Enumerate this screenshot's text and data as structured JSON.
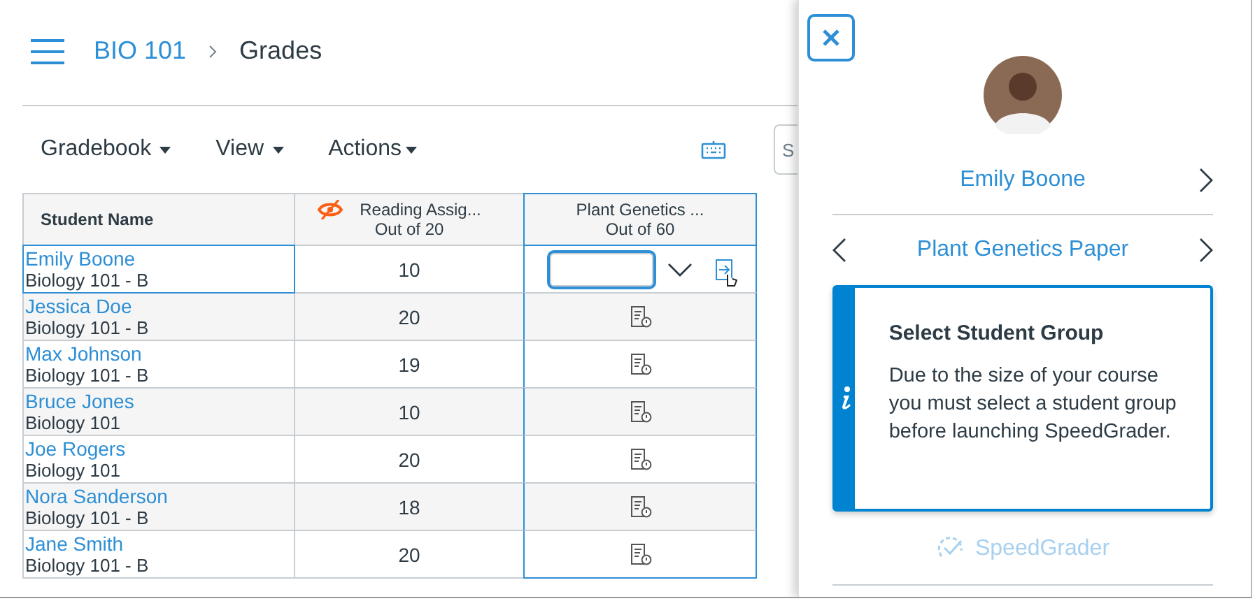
{
  "header": {
    "breadcrumb": [
      {
        "label": "BIO 101",
        "kind": "link"
      },
      {
        "label": "Grades",
        "kind": "current"
      }
    ]
  },
  "toolbar": {
    "menus": [
      {
        "label": "Gradebook"
      },
      {
        "label": "View"
      },
      {
        "label": "Actions"
      }
    ],
    "search": {
      "placeholder": "S"
    }
  },
  "table": {
    "columns": [
      {
        "title": "Student Name",
        "kind": "student"
      },
      {
        "title": "Reading Assig...",
        "subtitle": "Out of 20",
        "kind": "assignment",
        "muted": true,
        "selected": false
      },
      {
        "title": "Plant Genetics ...",
        "subtitle": "Out of 60",
        "kind": "assignment",
        "muted": false,
        "selected": true
      }
    ],
    "rows": [
      {
        "name": "Emily Boone",
        "section": "Biology 101 - B",
        "reading": "10",
        "kind": "editing",
        "selected": true
      },
      {
        "name": "Jessica Doe",
        "section": "Biology 101 - B",
        "reading": "20",
        "kind": "ungraded",
        "selected": false
      },
      {
        "name": "Max Johnson",
        "section": "Biology 101 - B",
        "reading": "19",
        "kind": "ungraded",
        "selected": false
      },
      {
        "name": "Bruce Jones",
        "section": "Biology 101",
        "reading": "10",
        "kind": "ungraded",
        "selected": false
      },
      {
        "name": "Joe Rogers",
        "section": "Biology 101",
        "reading": "20",
        "kind": "ungraded",
        "selected": false
      },
      {
        "name": "Nora Sanderson",
        "section": "Biology 101 - B",
        "reading": "18",
        "kind": "ungraded",
        "selected": false
      },
      {
        "name": "Jane Smith",
        "section": "Biology 101 - B",
        "reading": "20",
        "kind": "ungraded",
        "selected": false
      }
    ]
  },
  "tray": {
    "student": "Emily Boone",
    "assignment": "Plant Genetics Paper",
    "alert": {
      "title": "Select Student Group",
      "message": "Due to the size of your course you must select a student group before launching SpeedGrader."
    },
    "speedgrader": {
      "label": "SpeedGrader",
      "disabled": true
    }
  }
}
